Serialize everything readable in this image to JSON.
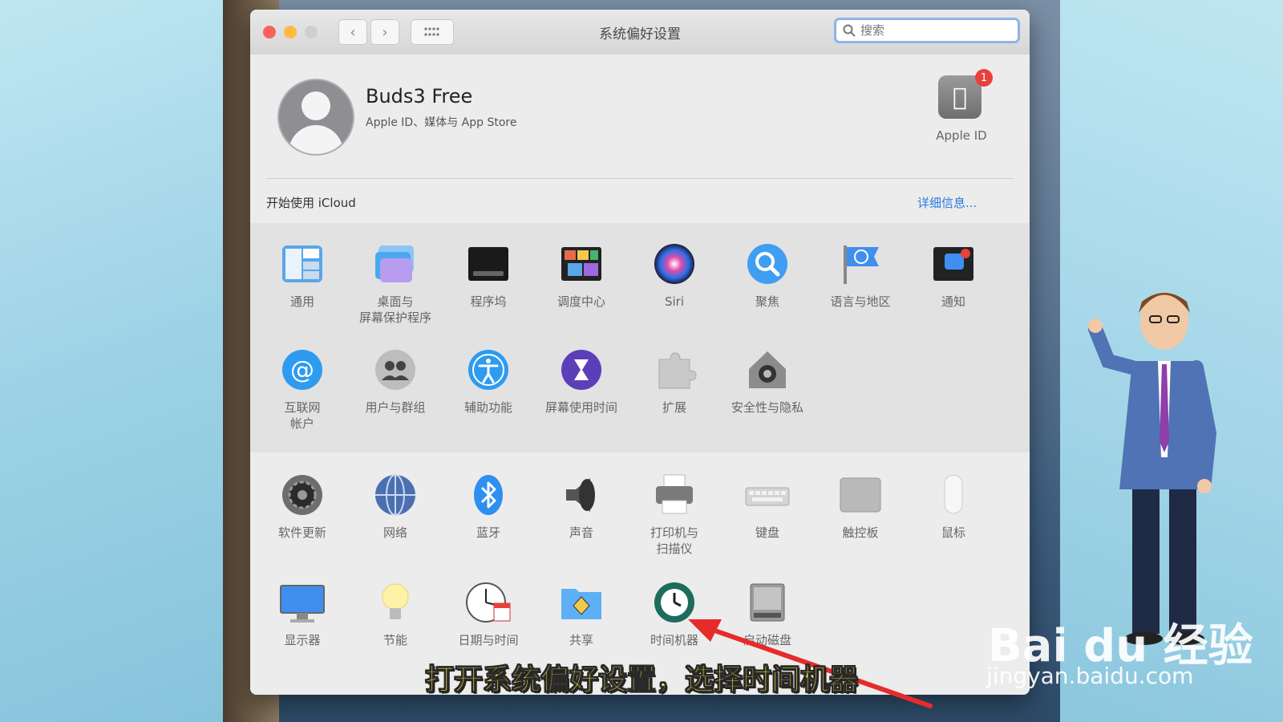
{
  "window": {
    "title": "系统偏好设置"
  },
  "search": {
    "placeholder": "搜索"
  },
  "account": {
    "name": "Buds3 Free",
    "subtitle": "Apple ID、媒体与 App Store",
    "appleid_label": "Apple ID",
    "badge": "1",
    "icloud_text": "开始使用 iCloud",
    "details_link": "详细信息..."
  },
  "panes_row1": [
    {
      "label": "通用"
    },
    {
      "label": "桌面与\n屏幕保护程序"
    },
    {
      "label": "程序坞"
    },
    {
      "label": "调度中心"
    },
    {
      "label": "Siri"
    },
    {
      "label": "聚焦"
    },
    {
      "label": "语言与地区"
    },
    {
      "label": "通知"
    }
  ],
  "panes_row2": [
    {
      "label": "互联网\n帐户"
    },
    {
      "label": "用户与群组"
    },
    {
      "label": "辅助功能"
    },
    {
      "label": "屏幕使用时间"
    },
    {
      "label": "扩展"
    },
    {
      "label": "安全性与隐私"
    }
  ],
  "panes_row3": [
    {
      "label": "软件更新"
    },
    {
      "label": "网络"
    },
    {
      "label": "蓝牙"
    },
    {
      "label": "声音"
    },
    {
      "label": "打印机与\n扫描仪"
    },
    {
      "label": "键盘"
    },
    {
      "label": "触控板"
    },
    {
      "label": "鼠标"
    }
  ],
  "panes_row4": [
    {
      "label": "显示器"
    },
    {
      "label": "节能"
    },
    {
      "label": "日期与时间"
    },
    {
      "label": "共享"
    },
    {
      "label": "时间机器"
    },
    {
      "label": "启动磁盘"
    }
  ],
  "overlay": {
    "subtitle": "打开系统偏好设置，选择时间机器",
    "watermark": "Bai du 经验",
    "watermark_url": "jingyan.baidu.com"
  },
  "colors": {
    "accent": "#2a7ae2",
    "close": "#fc605c",
    "minimize": "#fdbc40",
    "subtitle": "#ffec3a"
  }
}
